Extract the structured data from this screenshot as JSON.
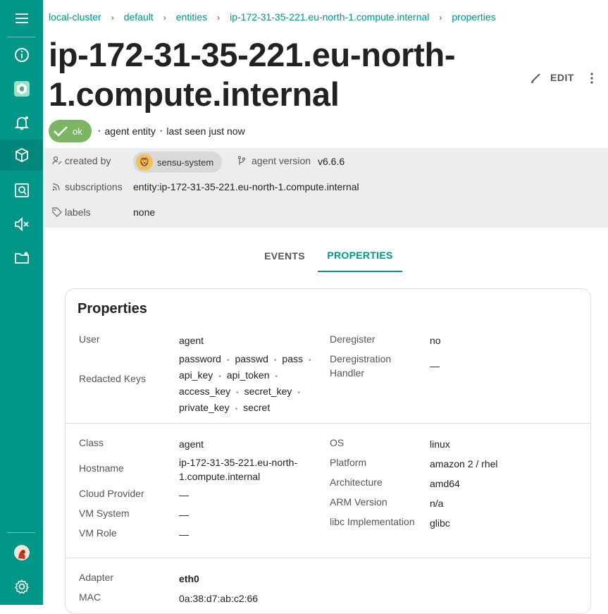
{
  "sidebar": {
    "items": [
      {
        "icon": "hamburger-menu-icon"
      },
      {
        "icon": "info-icon"
      },
      {
        "icon": "sensu-logo-icon"
      },
      {
        "icon": "bell-icon"
      },
      {
        "icon": "cube-icon"
      },
      {
        "icon": "search-doc-icon"
      },
      {
        "icon": "mute-icon"
      },
      {
        "icon": "folder-icon"
      },
      {
        "icon": "user-avatar-icon"
      },
      {
        "icon": "gear-icon"
      }
    ],
    "active": "cube-icon"
  },
  "breadcrumb": {
    "items": [
      "local-cluster",
      "default",
      "entities",
      "ip-172-31-35-221.eu-north-1.compute.internal",
      "properties"
    ],
    "separator": "›"
  },
  "page_title": "ip-172-31-35-221.eu-north-1.compute.internal",
  "actions": {
    "edit_label": "EDIT"
  },
  "status": {
    "chip_label": "ok",
    "entity_type": "agent entity",
    "last_seen": "last seen just now"
  },
  "info": {
    "created_by_label": "created by",
    "created_by_value": "sensu-system",
    "agent_version_label": "agent version",
    "agent_version_value": "v6.6.6",
    "subscriptions_label": "subscriptions",
    "subscriptions_value": "entity:ip-172-31-35-221.eu-north-1.compute.internal",
    "labels_label": "labels",
    "labels_value": "none"
  },
  "tabs": [
    {
      "label": "EVENTS",
      "active": false
    },
    {
      "label": "PROPERTIES",
      "active": true
    }
  ],
  "properties": {
    "title": "Properties",
    "user_label": "User",
    "user_value": "agent",
    "redacted_label": "Redacted Keys",
    "redacted_keys": [
      "password",
      "passwd",
      "pass",
      "api_key",
      "api_token",
      "access_key",
      "secret_key",
      "private_key",
      "secret"
    ],
    "deregister_label": "Deregister",
    "deregister_value": "no",
    "dereg_handler_label_1": "Deregistration",
    "dereg_handler_label_2": "Handler",
    "dereg_handler_value": "—",
    "class_label": "Class",
    "class_value": "agent",
    "hostname_label": "Hostname",
    "hostname_value_1": "ip-172-31-35-221.eu-north-",
    "hostname_value_2": "1.compute.internal",
    "cloud_label": "Cloud Provider",
    "cloud_value": "—",
    "vm_system_label": "VM System",
    "vm_system_value": "—",
    "vm_role_label": "VM Role",
    "vm_role_value": "—",
    "os_label": "OS",
    "os_value": "linux",
    "platform_label": "Platform",
    "platform_value": "amazon 2 / rhel",
    "arch_label": "Architecture",
    "arch_value": "amd64",
    "arm_label": "ARM Version",
    "arm_value": "n/a",
    "libc_label": "libc Implementation",
    "libc_value": "glibc",
    "adapter_label": "Adapter",
    "adapter_value": "eth0",
    "mac_label": "MAC",
    "mac_value": "0a:38:d7:ab:c2:66"
  },
  "colors": {
    "accent": "#009688",
    "ok_chip": "#7cb564",
    "info_bg": "#ededed"
  }
}
